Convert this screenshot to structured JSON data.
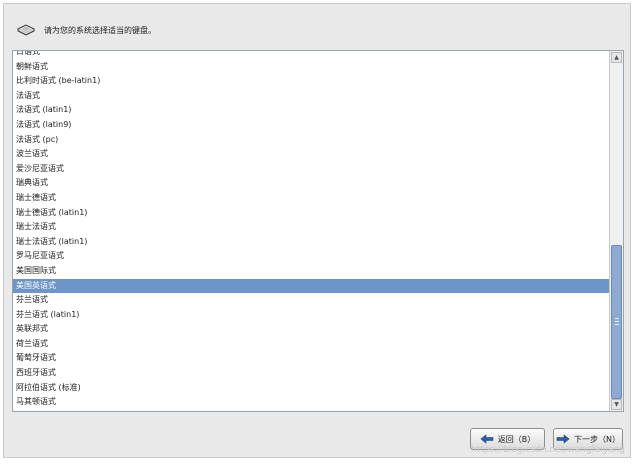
{
  "header": {
    "prompt": "请为您的系统选择适当的键盘。",
    "icon": "keyboard-icon"
  },
  "keyboard_list": {
    "items": [
      "日语式",
      "朝鲜语式",
      "比利时语式 (be-latin1)",
      "法语式",
      "法语式 (latin1)",
      "法语式 (latin9)",
      "法语式 (pc)",
      "波兰语式",
      "爱沙尼亚语式",
      "瑞典语式",
      "瑞士德语式",
      "瑞士德语式 (latin1)",
      "瑞士法语式",
      "瑞士法语式 (latin1)",
      "罗马尼亚语式",
      "美国国际式",
      "美国英语式",
      "芬兰语式",
      "芬兰语式 (latin1)",
      "英联邦式",
      "荷兰语式",
      "葡萄牙语式",
      "西班牙语式",
      "阿拉伯语式 (标准)",
      "马其顿语式"
    ],
    "selected_index": 16,
    "selected_color": "#6e95c8"
  },
  "buttons": {
    "back_label": "返回（B）",
    "next_label": "下一步（N）"
  },
  "watermark": "https://blog.csdn.net/wangfeiyang"
}
